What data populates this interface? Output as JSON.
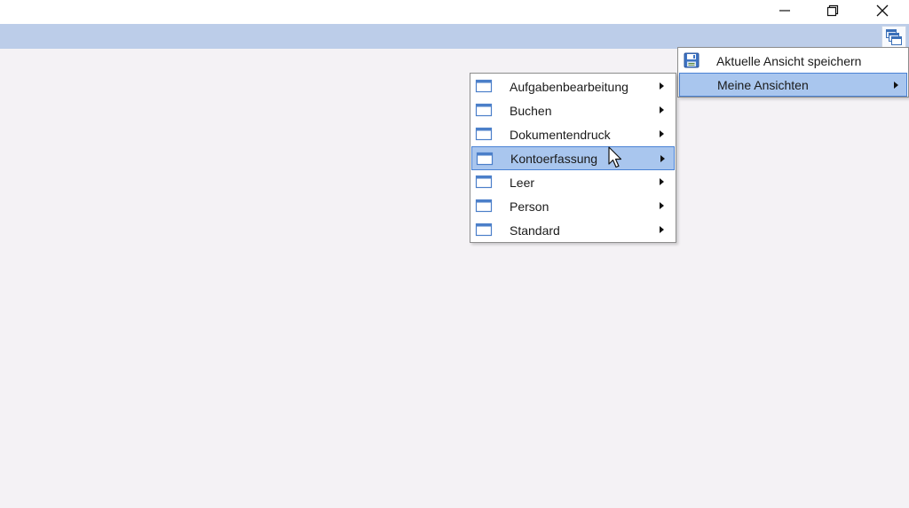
{
  "window": {
    "controls": [
      {
        "name": "minimize-button",
        "icon": "minimize-icon"
      },
      {
        "name": "restore-button",
        "icon": "restore-icon"
      },
      {
        "name": "close-button",
        "icon": "close-icon"
      }
    ]
  },
  "ribbon": {
    "views_button_icon": "views-icon",
    "color": "#bccde9"
  },
  "main_menu": {
    "items": [
      {
        "label": "Aktuelle Ansicht speichern",
        "icon": "save-icon",
        "submenu": false,
        "highlighted": false
      },
      {
        "label": "Meine Ansichten",
        "icon": "",
        "submenu": true,
        "highlighted": true
      }
    ]
  },
  "views_menu": {
    "items": [
      {
        "label": "Aufgabenbearbeitung",
        "icon": "window-icon",
        "submenu": true,
        "highlighted": false
      },
      {
        "label": "Buchen",
        "icon": "window-icon",
        "submenu": true,
        "highlighted": false
      },
      {
        "label": "Dokumentendruck",
        "icon": "window-icon",
        "submenu": true,
        "highlighted": false
      },
      {
        "label": "Kontoerfassung",
        "icon": "window-icon",
        "submenu": true,
        "highlighted": true
      },
      {
        "label": "Leer",
        "icon": "window-icon",
        "submenu": true,
        "highlighted": false
      },
      {
        "label": "Person",
        "icon": "window-icon",
        "submenu": true,
        "highlighted": false
      },
      {
        "label": "Standard",
        "icon": "window-icon",
        "submenu": true,
        "highlighted": false
      }
    ]
  },
  "colors": {
    "highlight": "#a9c6ee",
    "highlight_border": "#4a82d4",
    "background": "#f4f2f5"
  }
}
